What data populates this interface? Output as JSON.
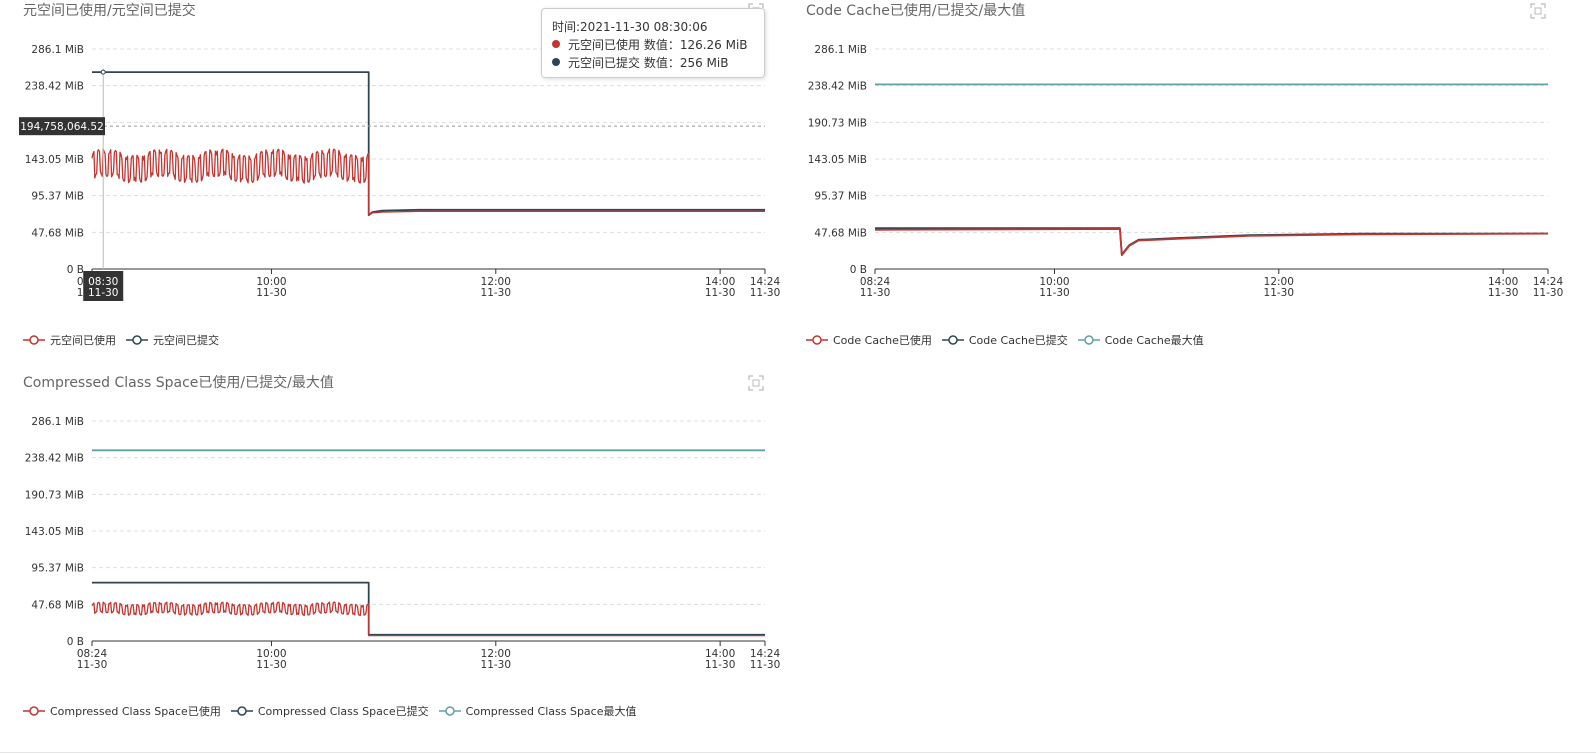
{
  "panels": [
    {
      "title": "元空间已使用/元空间已提交",
      "legend": [
        {
          "name": "元空间已使用",
          "color": "#c23531"
        },
        {
          "name": "元空间已提交",
          "color": "#2f4554"
        }
      ],
      "tooltip": {
        "time_label": "时间:2021-11-30 08:30:06",
        "rows": [
          {
            "text": "元空间已使用 数值：126.26 MiB",
            "color": "#c23531"
          },
          {
            "text": "元空间已提交 数值：256 MiB",
            "color": "#2f4554"
          }
        ]
      },
      "crosshair": {
        "x_label": [
          "08:30",
          "11-30"
        ],
        "y_label": "194,758,064.52",
        "x_minutes": 6,
        "y_mib": 185.73
      }
    },
    {
      "title": "Code Cache已使用/已提交/最大值",
      "legend": [
        {
          "name": "Code Cache已使用",
          "color": "#c23531"
        },
        {
          "name": "Code Cache已提交",
          "color": "#2f4554"
        },
        {
          "name": "Code Cache最大值",
          "color": "#61a0a8"
        }
      ]
    },
    {
      "title": "Compressed Class Space已使用/已提交/最大值",
      "legend": [
        {
          "name": "Compressed Class Space已使用",
          "color": "#c23531"
        },
        {
          "name": "Compressed Class Space已提交",
          "color": "#2f4554"
        },
        {
          "name": "Compressed Class Space最大值",
          "color": "#61a0a8"
        }
      ]
    }
  ],
  "chart_data": [
    {
      "type": "line",
      "title": "元空间已使用/元空间已提交",
      "y_ticks": [
        "0 B",
        "47.68 MiB",
        "95.37 MiB",
        "143.05 MiB",
        "190.73 MiB",
        "238.42 MiB",
        "286.1 MiB"
      ],
      "y_tick_values_mib": [
        0,
        47.68,
        95.37,
        143.05,
        190.73,
        238.42,
        286.1
      ],
      "ylim_mib": [
        0,
        286.1
      ],
      "x_ticks": [
        [
          "08:24",
          "11-30"
        ],
        [
          "10:00",
          "11-30"
        ],
        [
          "12:00",
          "11-30"
        ],
        [
          "14:00",
          "11-30"
        ],
        [
          "14:24",
          "11-30"
        ]
      ],
      "x_tick_minutes": [
        0,
        96,
        216,
        336,
        360
      ],
      "xlim_minutes": [
        0,
        360
      ],
      "series": [
        {
          "name": "元空间已使用",
          "color": "#c23531",
          "shape": "noisy",
          "base_mib": 134,
          "amplitude_mib": 18,
          "period_minutes": 3,
          "until_minutes": 148,
          "after": [
            [
              148,
              70
            ],
            [
              150,
              73
            ],
            [
              155,
              74
            ],
            [
              175,
              75
            ],
            [
              360,
              75
            ]
          ]
        },
        {
          "name": "元空间已提交",
          "color": "#2f4554",
          "shape": "steps",
          "points": [
            [
              0,
              256
            ],
            [
              148,
              256
            ],
            [
              148,
              70
            ],
            [
              150,
              74
            ],
            [
              155,
              76
            ],
            [
              175,
              77
            ],
            [
              360,
              77
            ]
          ]
        }
      ]
    },
    {
      "type": "line",
      "title": "Code Cache已使用/已提交/最大值",
      "y_ticks": [
        "0 B",
        "47.68 MiB",
        "95.37 MiB",
        "143.05 MiB",
        "190.73 MiB",
        "238.42 MiB",
        "286.1 MiB"
      ],
      "y_tick_values_mib": [
        0,
        47.68,
        95.37,
        143.05,
        190.73,
        238.42,
        286.1
      ],
      "ylim_mib": [
        0,
        286.1
      ],
      "x_ticks": [
        [
          "08:24",
          "11-30"
        ],
        [
          "10:00",
          "11-30"
        ],
        [
          "12:00",
          "11-30"
        ],
        [
          "14:00",
          "11-30"
        ],
        [
          "14:24",
          "11-30"
        ]
      ],
      "x_tick_minutes": [
        0,
        96,
        216,
        336,
        360
      ],
      "xlim_minutes": [
        0,
        360
      ],
      "series": [
        {
          "name": "Code Cache已使用",
          "color": "#c23531",
          "shape": "steps",
          "points": [
            [
              0,
              51
            ],
            [
              131,
              52
            ],
            [
              132,
              18
            ],
            [
              136,
              30
            ],
            [
              141,
              37
            ],
            [
              160,
              39
            ],
            [
              200,
              43
            ],
            [
              260,
              45
            ],
            [
              360,
              46
            ]
          ]
        },
        {
          "name": "Code Cache已提交",
          "color": "#2f4554",
          "shape": "steps",
          "points": [
            [
              0,
              53
            ],
            [
              131,
              53
            ],
            [
              132,
              19
            ],
            [
              136,
              31
            ],
            [
              141,
              38
            ],
            [
              160,
              40
            ],
            [
              200,
              44
            ],
            [
              260,
              46
            ],
            [
              360,
              46
            ]
          ]
        },
        {
          "name": "Code Cache最大值",
          "color": "#61a0a8",
          "shape": "steps",
          "points": [
            [
              0,
              240
            ],
            [
              360,
              240
            ]
          ]
        }
      ]
    },
    {
      "type": "line",
      "title": "Compressed Class Space已使用/已提交/最大值",
      "y_ticks": [
        "0 B",
        "47.68 MiB",
        "95.37 MiB",
        "143.05 MiB",
        "190.73 MiB",
        "238.42 MiB",
        "286.1 MiB"
      ],
      "y_tick_values_mib": [
        0,
        47.68,
        95.37,
        143.05,
        190.73,
        238.42,
        286.1
      ],
      "ylim_mib": [
        0,
        286.1
      ],
      "x_ticks": [
        [
          "08:24",
          "11-30"
        ],
        [
          "10:00",
          "11-30"
        ],
        [
          "12:00",
          "11-30"
        ],
        [
          "14:00",
          "11-30"
        ],
        [
          "14:24",
          "11-30"
        ]
      ],
      "x_tick_minutes": [
        0,
        96,
        216,
        336,
        360
      ],
      "xlim_minutes": [
        0,
        360
      ],
      "series": [
        {
          "name": "Compressed Class Space已使用",
          "color": "#c23531",
          "shape": "noisy",
          "base_mib": 42,
          "amplitude_mib": 7,
          "period_minutes": 3,
          "until_minutes": 148,
          "after": [
            [
              148,
              7
            ],
            [
              360,
              7
            ]
          ]
        },
        {
          "name": "Compressed Class Space已提交",
          "color": "#2f4554",
          "shape": "steps",
          "points": [
            [
              0,
              76
            ],
            [
              148,
              76
            ],
            [
              148,
              8
            ],
            [
              360,
              8
            ]
          ]
        },
        {
          "name": "Compressed Class Space最大值",
          "color": "#61a0a8",
          "shape": "steps",
          "points": [
            [
              0,
              248
            ],
            [
              360,
              248
            ]
          ]
        }
      ]
    }
  ]
}
